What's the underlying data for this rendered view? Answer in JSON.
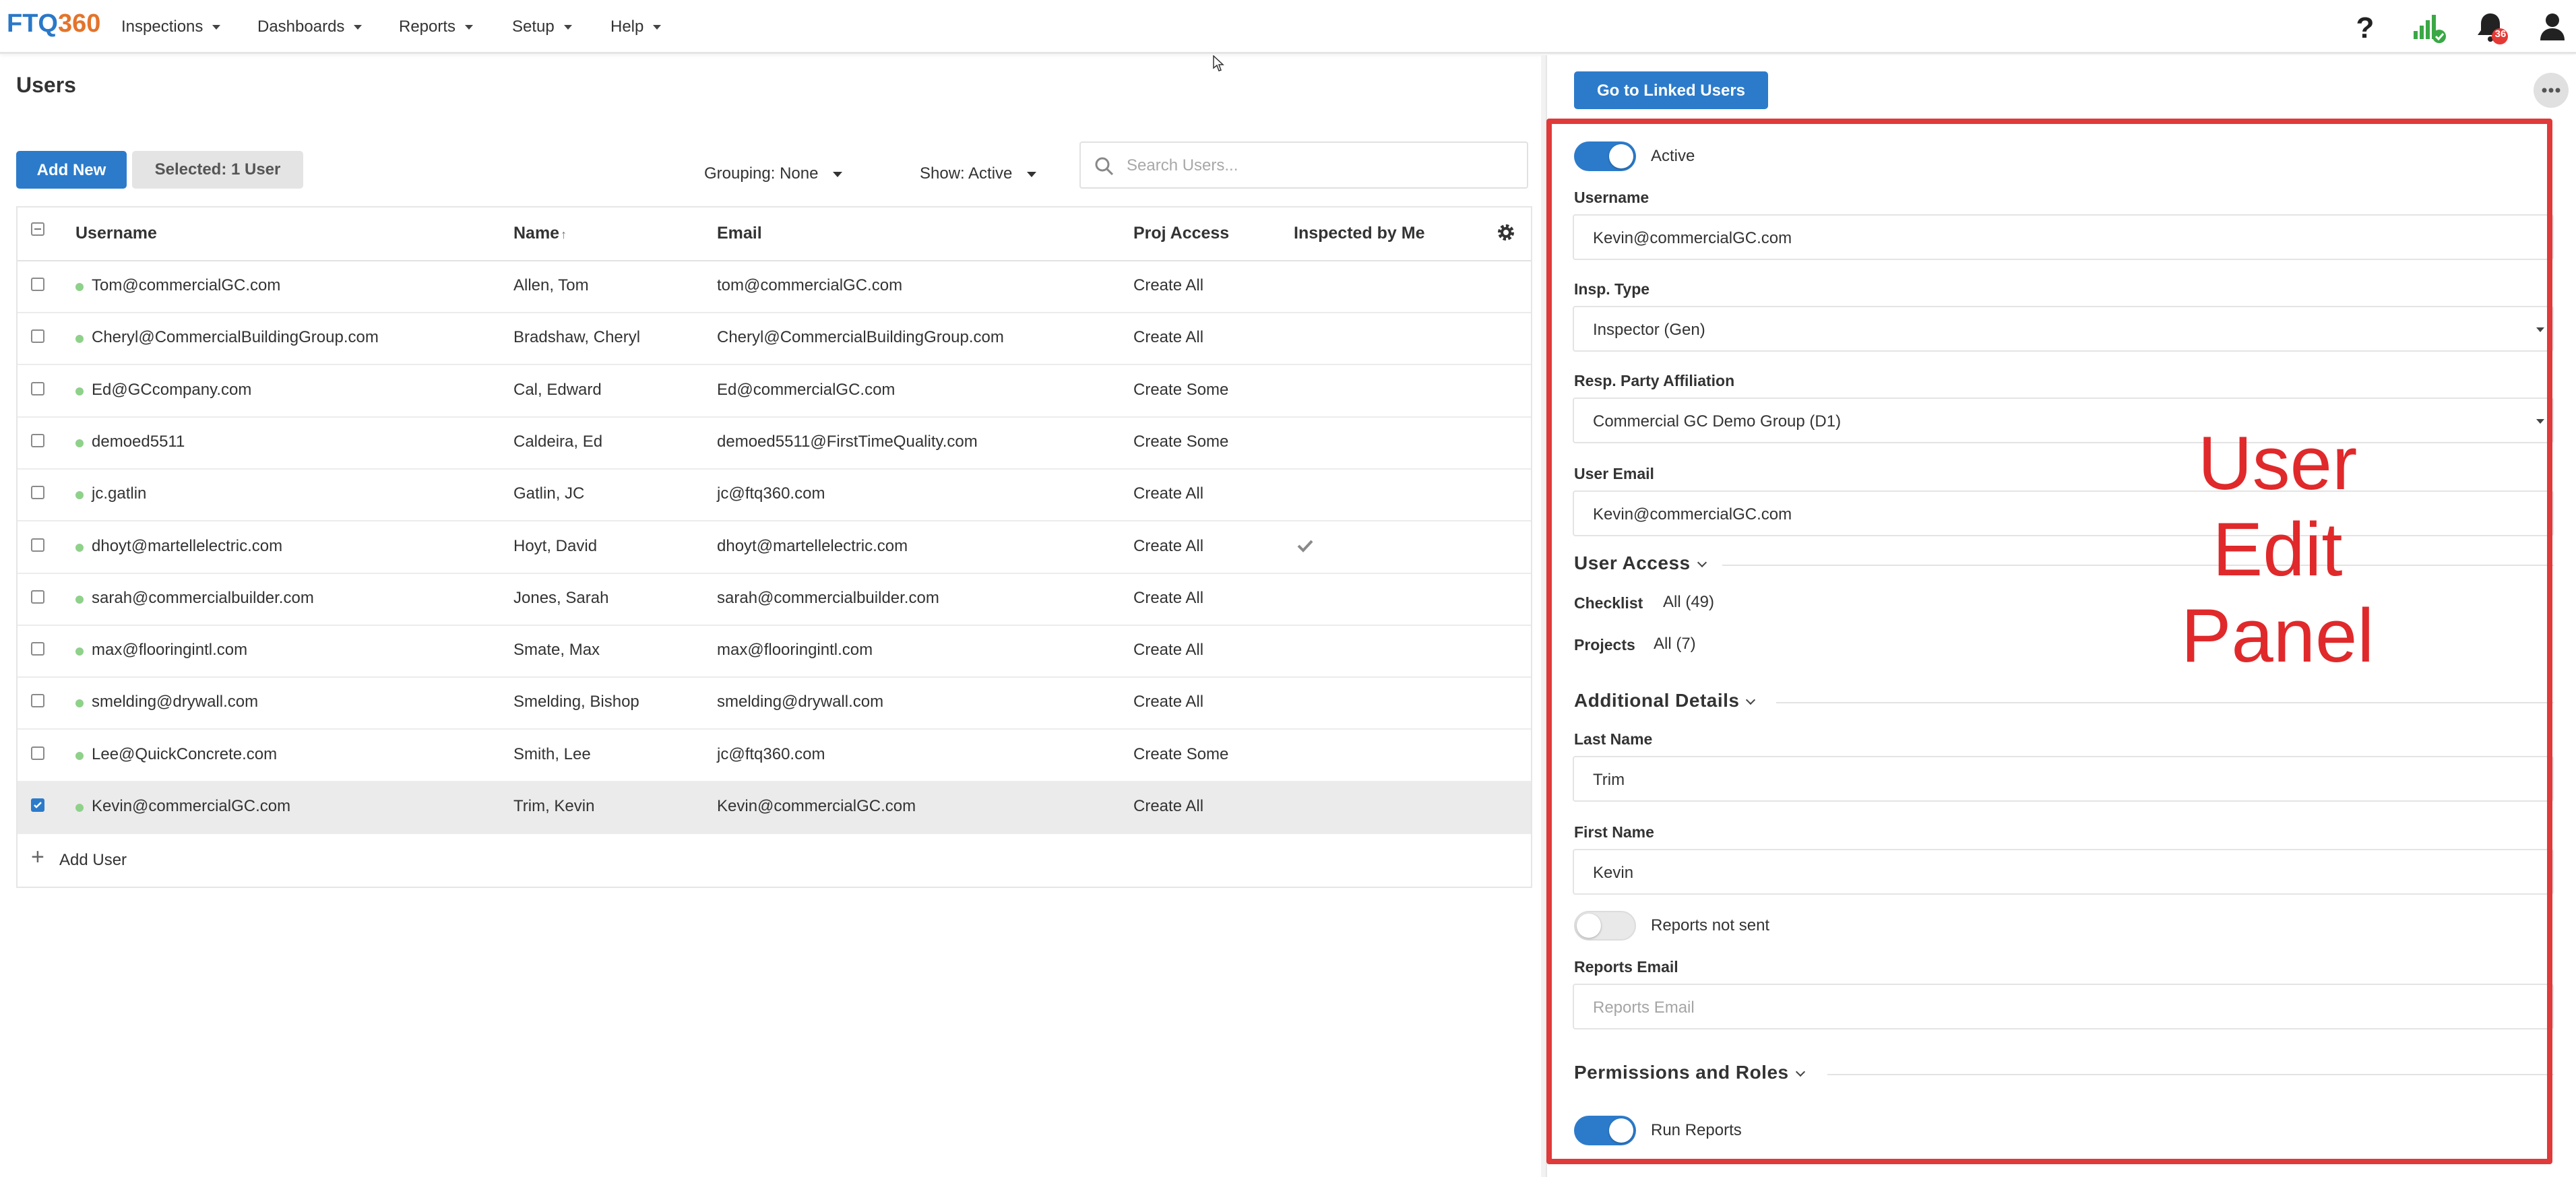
{
  "app": {
    "logo_part1": "FTQ",
    "logo_part2": "360"
  },
  "nav": {
    "menus": [
      "Inspections",
      "Dashboards",
      "Reports",
      "Setup",
      "Help"
    ],
    "notification_count": "36",
    "icons": [
      "help-icon",
      "signal-icon",
      "bell-icon",
      "user-icon"
    ]
  },
  "users_page": {
    "title": "Users",
    "add_new_label": "Add New",
    "selected_label": "Selected: 1 User",
    "grouping_label": "Grouping: None",
    "show_label": "Show: Active",
    "search_placeholder": "Search Users...",
    "columns": {
      "username": "Username",
      "name": "Name",
      "email": "Email",
      "proj_access": "Proj Access",
      "inspected_by_me": "Inspected by Me"
    },
    "rows": [
      {
        "username": "Tom@commercialGC.com",
        "name": "Allen, Tom",
        "email": "tom@commercialGC.com",
        "proj_access": "Create All",
        "inspected": false,
        "selected": false
      },
      {
        "username": "Cheryl@CommercialBuildingGroup.com",
        "name": "Bradshaw, Cheryl",
        "email": "Cheryl@CommercialBuildingGroup.com",
        "proj_access": "Create All",
        "inspected": false,
        "selected": false
      },
      {
        "username": "Ed@GCcompany.com",
        "name": "Cal, Edward",
        "email": "Ed@commercialGC.com",
        "proj_access": "Create Some",
        "inspected": false,
        "selected": false
      },
      {
        "username": "demoed5511",
        "name": "Caldeira, Ed",
        "email": "demoed5511@FirstTimeQuality.com",
        "proj_access": "Create Some",
        "inspected": false,
        "selected": false
      },
      {
        "username": "jc.gatlin",
        "name": "Gatlin, JC",
        "email": "jc@ftq360.com",
        "proj_access": "Create All",
        "inspected": false,
        "selected": false
      },
      {
        "username": "dhoyt@martellelectric.com",
        "name": "Hoyt, David",
        "email": "dhoyt@martellelectric.com",
        "proj_access": "Create All",
        "inspected": true,
        "selected": false
      },
      {
        "username": "sarah@commercialbuilder.com",
        "name": "Jones, Sarah",
        "email": "sarah@commercialbuilder.com",
        "proj_access": "Create All",
        "inspected": false,
        "selected": false
      },
      {
        "username": "max@flooringintl.com",
        "name": "Smate, Max",
        "email": "max@flooringintl.com",
        "proj_access": "Create All",
        "inspected": false,
        "selected": false
      },
      {
        "username": "smelding@drywall.com",
        "name": "Smelding, Bishop",
        "email": "smelding@drywall.com",
        "proj_access": "Create All",
        "inspected": false,
        "selected": false
      },
      {
        "username": "Lee@QuickConcrete.com",
        "name": "Smith, Lee",
        "email": "jc@ftq360.com",
        "proj_access": "Create Some",
        "inspected": false,
        "selected": false
      },
      {
        "username": "Kevin@commercialGC.com",
        "name": "Trim, Kevin",
        "email": "Kevin@commercialGC.com",
        "proj_access": "Create All",
        "inspected": false,
        "selected": true
      }
    ],
    "add_user_label": "Add User"
  },
  "edit_panel": {
    "linked_users_label": "Go to Linked Users",
    "active_label": "Active",
    "active": true,
    "username_label": "Username",
    "username_value": "Kevin@commercialGC.com",
    "insp_type_label": "Insp. Type",
    "insp_type_value": "Inspector (Gen)",
    "resp_party_label": "Resp. Party Affiliation",
    "resp_party_value": "Commercial GC Demo Group (D1)",
    "user_email_label": "User Email",
    "user_email_value": "Kevin@commercialGC.com",
    "user_access_heading": "User Access",
    "checklist_label": "Checklist",
    "checklist_value": "All (49)",
    "projects_label": "Projects",
    "projects_value": "All (7)",
    "additional_details_heading": "Additional Details",
    "last_name_label": "Last Name",
    "last_name_value": "Trim",
    "first_name_label": "First Name",
    "first_name_value": "Kevin",
    "reports_not_sent_label": "Reports not sent",
    "reports_not_sent": false,
    "reports_email_label": "Reports Email",
    "reports_email_placeholder": "Reports Email",
    "permissions_heading": "Permissions and Roles",
    "run_reports_label": "Run Reports",
    "run_reports": true
  },
  "annotation": {
    "line1": "User",
    "line2": "Edit",
    "line3": "Panel",
    "color": "#e0292b"
  },
  "colors": {
    "primary": "#2c7bcb",
    "logo_orange": "#e3742b",
    "active_dot": "#8fd18a",
    "badge_red": "#e53935"
  }
}
